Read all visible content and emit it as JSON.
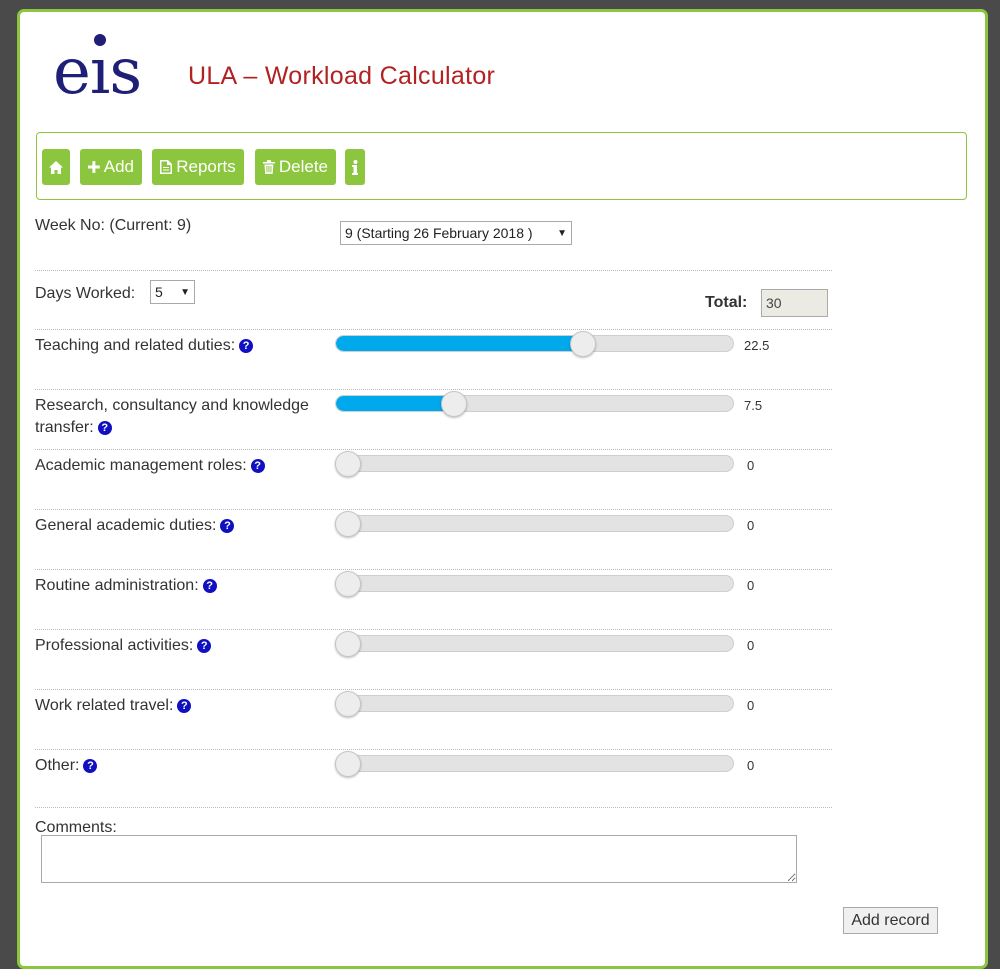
{
  "header": {
    "logo_text": "eis",
    "title": "ULA – Workload Calculator"
  },
  "toolbar": {
    "home_icon": "home-icon",
    "add_label": "Add",
    "reports_label": "Reports",
    "delete_label": "Delete",
    "info_icon": "info-icon"
  },
  "week": {
    "label": "Week No: (Current: 9)",
    "selected": "9 (Starting 26 February 2018 )"
  },
  "days": {
    "label": "Days Worked:",
    "selected": "5"
  },
  "total": {
    "label": "Total:",
    "value": "30"
  },
  "sliders": [
    {
      "label": "Teaching and related duties:",
      "value": "22.5",
      "fraction": 0.63
    },
    {
      "label_line1": "Research, consultancy and knowledge",
      "label_line2": "transfer:",
      "value": "7.5",
      "fraction": 0.285
    },
    {
      "label": "Academic management roles:",
      "value": "0",
      "fraction": 0
    },
    {
      "label": "General academic duties:",
      "value": "0",
      "fraction": 0
    },
    {
      "label": "Routine administration:",
      "value": "0",
      "fraction": 0
    },
    {
      "label": "Professional activities:",
      "value": "0",
      "fraction": 0
    },
    {
      "label": "Work related travel:",
      "value": "0",
      "fraction": 0
    },
    {
      "label": "Other:",
      "value": "0",
      "fraction": 0
    }
  ],
  "help_glyph": "?",
  "comments": {
    "label": "Comments:",
    "value": ""
  },
  "add_record_label": "Add record",
  "colors": {
    "accent": "#8cc63f",
    "title": "#b22222",
    "logo": "#1f1f77",
    "slider_fill": "#00a9ec",
    "help_icon": "#1010c0"
  }
}
